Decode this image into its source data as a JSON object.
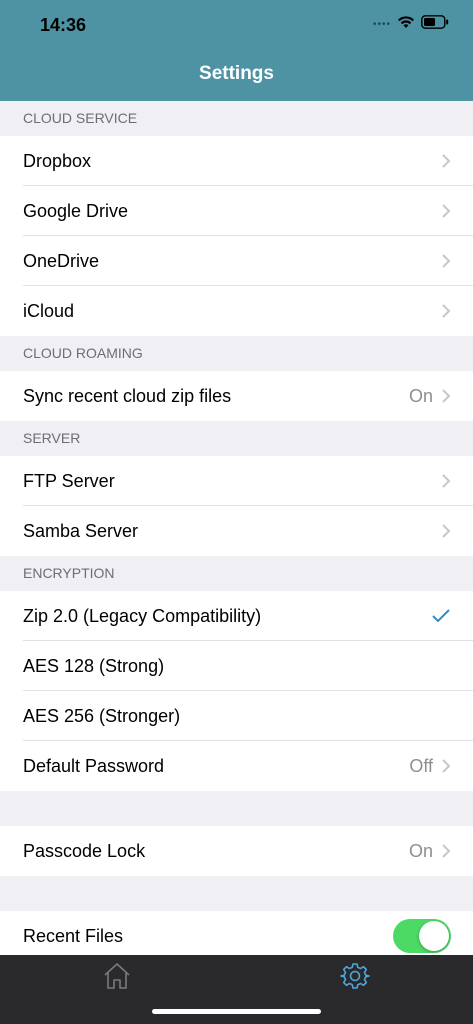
{
  "status": {
    "time": "14:36"
  },
  "nav": {
    "title": "Settings"
  },
  "sections": {
    "cloud_service": {
      "header": "CLOUD SERVICE",
      "items": [
        "Dropbox",
        "Google Drive",
        "OneDrive",
        "iCloud"
      ]
    },
    "cloud_roaming": {
      "header": "CLOUD ROAMING",
      "sync_label": "Sync recent cloud zip files",
      "sync_value": "On"
    },
    "server": {
      "header": "SERVER",
      "items": [
        "FTP Server",
        "Samba Server"
      ]
    },
    "encryption": {
      "header": "ENCRYPTION",
      "options": [
        "Zip 2.0 (Legacy Compatibility)",
        "AES 128 (Strong)",
        "AES 256 (Stronger)"
      ],
      "selected": "Zip 2.0 (Legacy Compatibility)",
      "default_password_label": "Default Password",
      "default_password_value": "Off"
    },
    "passcode": {
      "label": "Passcode Lock",
      "value": "On"
    },
    "recent": {
      "label": "Recent Files",
      "enabled": true
    }
  },
  "colors": {
    "nav_bg": "#4e93a4",
    "accent": "#2f8fc4",
    "toggle_on": "#4cd964",
    "tabbar_bg": "#2a2a2c"
  },
  "tabs": [
    {
      "icon": "home-icon",
      "active": false
    },
    {
      "icon": "gear-icon",
      "active": true
    }
  ]
}
